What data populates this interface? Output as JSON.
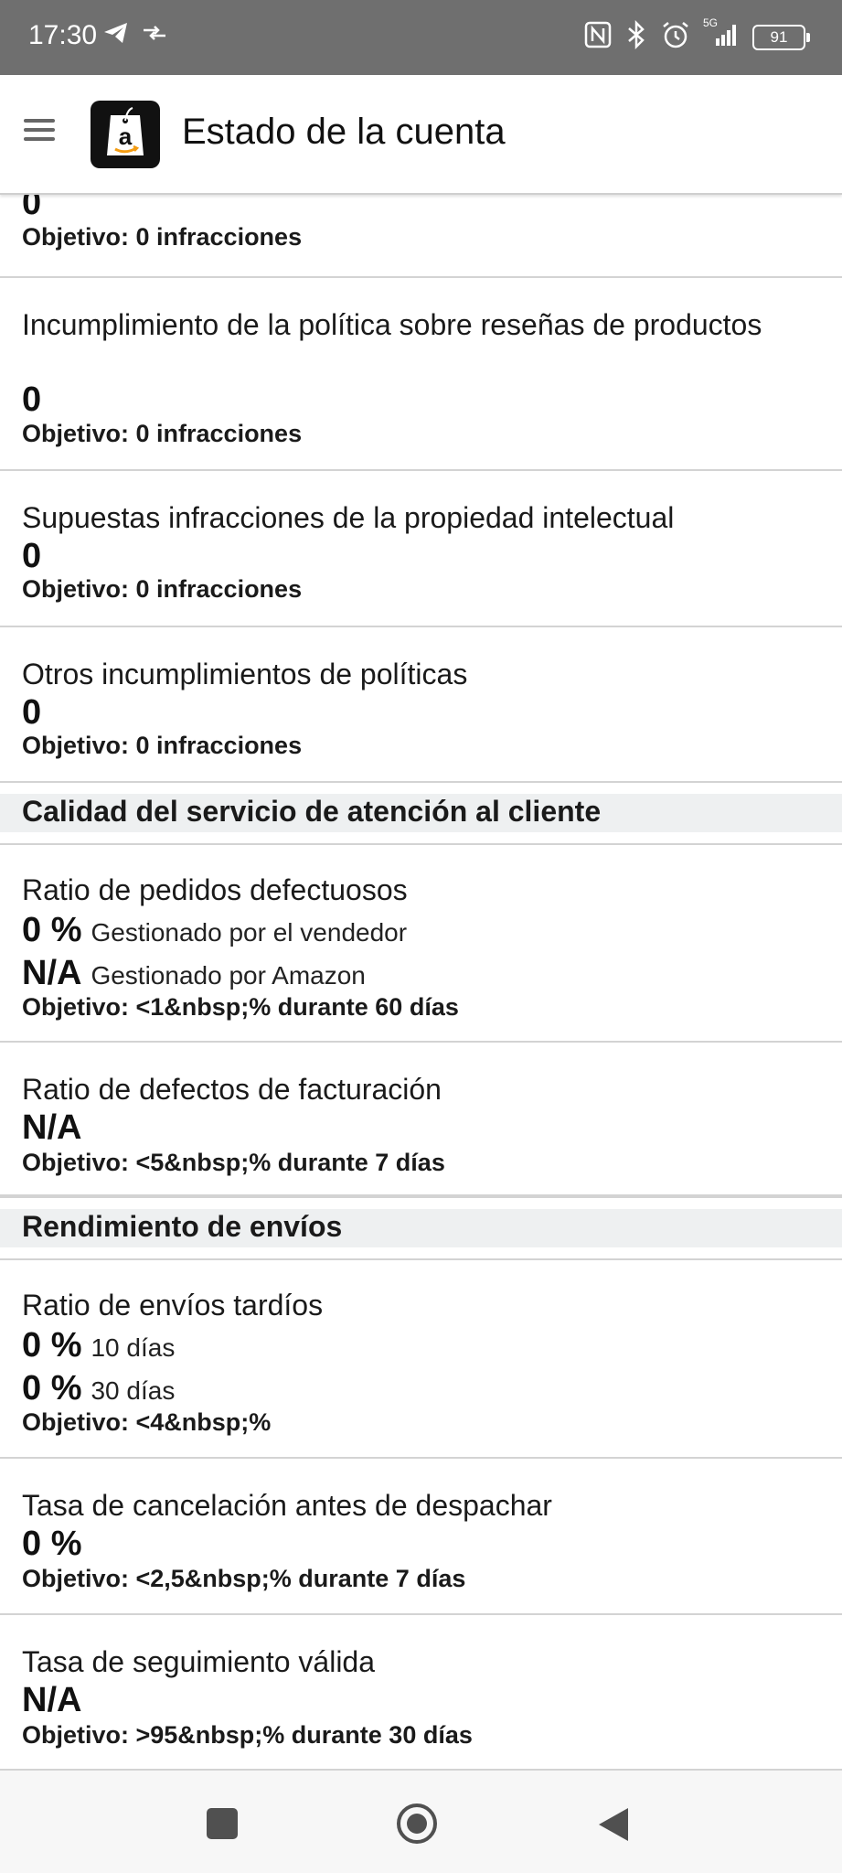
{
  "status_bar": {
    "time": "17:30",
    "network": "5G",
    "battery": "91",
    "icons": [
      "telegram-icon",
      "data-transfer-icon",
      "nfc-icon",
      "bluetooth-icon",
      "alarm-icon",
      "signal-icon",
      "battery-icon"
    ]
  },
  "app_bar": {
    "title": "Estado de la cuenta",
    "logo_letter": "a",
    "menu_icon": "hamburger-menu-icon"
  },
  "sections": {
    "partial_top": {
      "value": "0",
      "target": "Objetivo: 0 infracciones"
    },
    "review_policy": {
      "title": "Incumplimiento de la política sobre reseñas de productos",
      "value": "0",
      "target": "Objetivo: 0 infracciones"
    },
    "ip_infringements": {
      "title": "Supuestas infracciones de la propiedad intelectual",
      "value": "0",
      "target": "Objetivo: 0 infracciones"
    },
    "other_policy": {
      "title": "Otros incumplimientos de políticas",
      "value": "0",
      "target": "Objetivo: 0 infracciones"
    },
    "customer_service_header": "Calidad del servicio de atención al cliente",
    "order_defect_rate": {
      "title": "Ratio de pedidos defectuosos",
      "value1": "0 %",
      "label1": "Gestionado por el vendedor",
      "value2": "N/A",
      "label2": "Gestionado por Amazon",
      "target": "Objetivo: <1&nbsp;% durante 60 días"
    },
    "invoice_defect_rate": {
      "title": "Ratio de defectos de facturación",
      "value": "N/A",
      "target": "Objetivo: <5&nbsp;% durante 7 días"
    },
    "shipping_header": "Rendimiento de envíos",
    "late_shipment_rate": {
      "title": "Ratio de envíos tardíos",
      "value1": "0 %",
      "label1": "10 días",
      "value2": "0 %",
      "label2": "30 días",
      "target": "Objetivo: <4&nbsp;%"
    },
    "pre_fulfillment_cancel": {
      "title": "Tasa de cancelación antes de despachar",
      "value": "0 %",
      "target": "Objetivo: <2,5&nbsp;% durante 7 días"
    },
    "valid_tracking_rate": {
      "title": "Tasa de seguimiento válida",
      "value": "N/A",
      "target": "Objetivo: >95&nbsp;% durante 30 días"
    }
  },
  "nav_bar": {
    "buttons": [
      "recents-button",
      "home-button",
      "back-button"
    ]
  }
}
